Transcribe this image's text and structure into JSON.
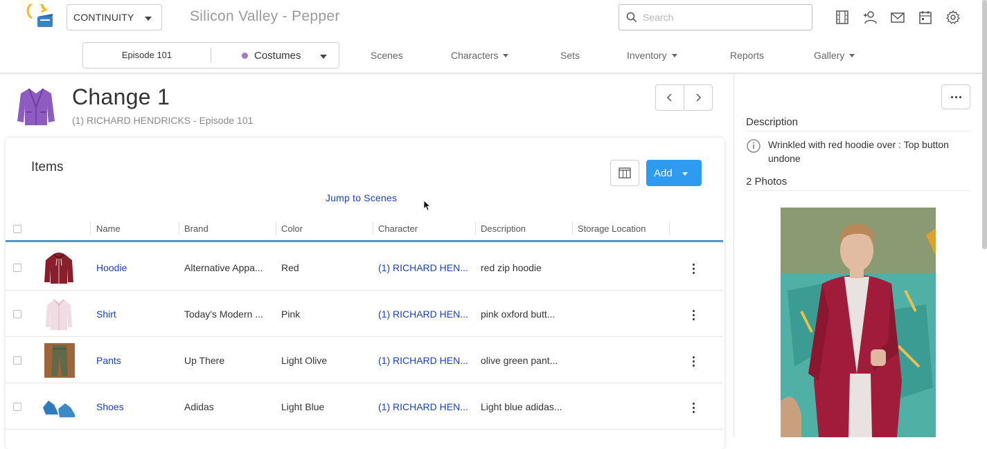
{
  "app": {
    "module": "CONTINUITY",
    "project_title": "Silicon Valley - Pepper",
    "search_placeholder": "Search"
  },
  "top_icons": [
    "film-icon",
    "add-user-icon",
    "mail-icon",
    "calendar-icon",
    "settings-gear-icon"
  ],
  "navbar": {
    "episode": "Episode 101",
    "department": "Costumes",
    "department_color": "#a07cc5",
    "items": [
      {
        "label": "Scenes",
        "has_dropdown": false
      },
      {
        "label": "Characters",
        "has_dropdown": true
      },
      {
        "label": "Sets",
        "has_dropdown": false
      },
      {
        "label": "Inventory",
        "has_dropdown": true
      },
      {
        "label": "Reports",
        "has_dropdown": false
      },
      {
        "label": "Gallery",
        "has_dropdown": true
      }
    ]
  },
  "page": {
    "title": "Change 1",
    "subtitle": "(1) RICHARD HENDRICKS - Episode 101"
  },
  "items_card": {
    "title": "Items",
    "add_label": "Add",
    "jump_link": "Jump to Scenes",
    "columns": [
      "Name",
      "Brand",
      "Color",
      "Character",
      "Description",
      "Storage Location"
    ],
    "rows": [
      {
        "name": "Hoodie",
        "brand": "Alternative Appa...",
        "color": "Red",
        "character": "(1) RICHARD HEN...",
        "description": "red zip hoodie",
        "storage": ""
      },
      {
        "name": "Shirt",
        "brand": "Today's Modern ...",
        "color": "Pink",
        "character": "(1) RICHARD HEN...",
        "description": "pink oxford butt...",
        "storage": ""
      },
      {
        "name": "Pants",
        "brand": "Up There",
        "color": "Light Olive",
        "character": "(1) RICHARD HEN...",
        "description": "olive green pant...",
        "storage": ""
      },
      {
        "name": "Shoes",
        "brand": "Adidas",
        "color": "Light Blue",
        "character": "(1) RICHARD HEN...",
        "description": "Light blue adidas...",
        "storage": ""
      }
    ]
  },
  "side_panel": {
    "description_heading": "Description",
    "description_text": "Wrinkled with red hoodie over : Top button undone",
    "photos_heading": "2 Photos"
  },
  "colors": {
    "accent_blue": "#2f9bf0",
    "link_blue": "#1a3fbf",
    "header_rule": "#5a93c7"
  }
}
